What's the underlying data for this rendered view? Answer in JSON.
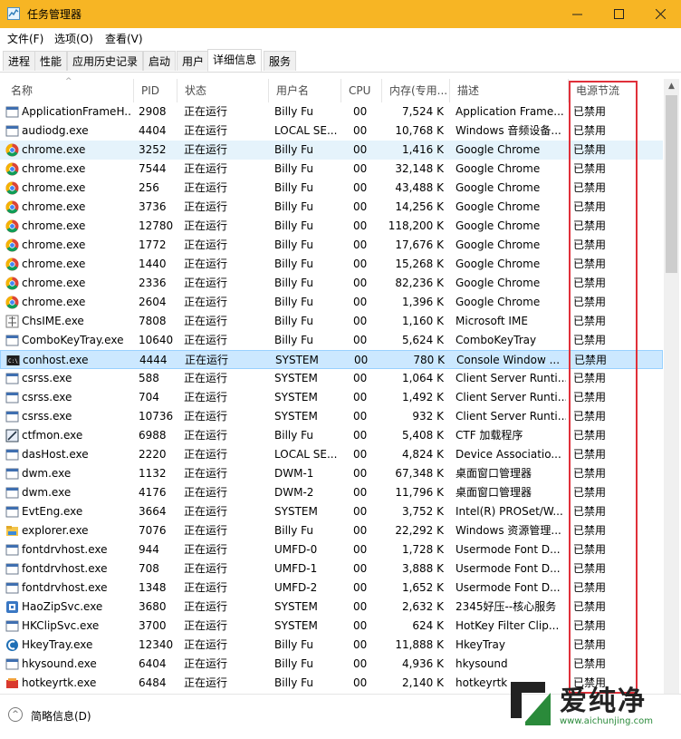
{
  "window": {
    "title": "任务管理器",
    "icon": "task-manager-icon"
  },
  "menu": [
    "文件(F)",
    "选项(O)",
    "查看(V)"
  ],
  "tabs": [
    "进程",
    "性能",
    "应用历史记录",
    "启动",
    "用户",
    "详细信息",
    "服务"
  ],
  "active_tab": "详细信息",
  "columns": [
    "名称",
    "PID",
    "状态",
    "用户名",
    "CPU",
    "内存(专用...",
    "描述",
    "电源节流"
  ],
  "rows": [
    {
      "icon": "generic-window-icon",
      "name": "ApplicationFrameH...",
      "pid": "2908",
      "status": "正在运行",
      "user": "Billy Fu",
      "cpu": "00",
      "mem": "7,524 K",
      "desc": "Application Frame...",
      "power": "已禁用"
    },
    {
      "icon": "generic-window-icon",
      "name": "audiodg.exe",
      "pid": "4404",
      "status": "正在运行",
      "user": "LOCAL SE...",
      "cpu": "00",
      "mem": "10,768 K",
      "desc": "Windows 音频设备...",
      "power": "已禁用"
    },
    {
      "icon": "chrome-icon",
      "name": "chrome.exe",
      "pid": "3252",
      "status": "正在运行",
      "user": "Billy Fu",
      "cpu": "00",
      "mem": "1,416 K",
      "desc": "Google Chrome",
      "power": "已禁用"
    },
    {
      "icon": "chrome-icon",
      "name": "chrome.exe",
      "pid": "7544",
      "status": "正在运行",
      "user": "Billy Fu",
      "cpu": "00",
      "mem": "32,148 K",
      "desc": "Google Chrome",
      "power": "已禁用"
    },
    {
      "icon": "chrome-icon",
      "name": "chrome.exe",
      "pid": "256",
      "status": "正在运行",
      "user": "Billy Fu",
      "cpu": "00",
      "mem": "43,488 K",
      "desc": "Google Chrome",
      "power": "已禁用"
    },
    {
      "icon": "chrome-icon",
      "name": "chrome.exe",
      "pid": "3736",
      "status": "正在运行",
      "user": "Billy Fu",
      "cpu": "00",
      "mem": "14,256 K",
      "desc": "Google Chrome",
      "power": "已禁用"
    },
    {
      "icon": "chrome-icon",
      "name": "chrome.exe",
      "pid": "12780",
      "status": "正在运行",
      "user": "Billy Fu",
      "cpu": "00",
      "mem": "118,200 K",
      "desc": "Google Chrome",
      "power": "已禁用"
    },
    {
      "icon": "chrome-icon",
      "name": "chrome.exe",
      "pid": "1772",
      "status": "正在运行",
      "user": "Billy Fu",
      "cpu": "00",
      "mem": "17,676 K",
      "desc": "Google Chrome",
      "power": "已禁用"
    },
    {
      "icon": "chrome-icon",
      "name": "chrome.exe",
      "pid": "1440",
      "status": "正在运行",
      "user": "Billy Fu",
      "cpu": "00",
      "mem": "15,268 K",
      "desc": "Google Chrome",
      "power": "已禁用"
    },
    {
      "icon": "chrome-icon",
      "name": "chrome.exe",
      "pid": "2336",
      "status": "正在运行",
      "user": "Billy Fu",
      "cpu": "00",
      "mem": "82,236 K",
      "desc": "Google Chrome",
      "power": "已禁用"
    },
    {
      "icon": "chrome-icon",
      "name": "chrome.exe",
      "pid": "2604",
      "status": "正在运行",
      "user": "Billy Fu",
      "cpu": "00",
      "mem": "1,396 K",
      "desc": "Google Chrome",
      "power": "已禁用"
    },
    {
      "icon": "ime-icon",
      "name": "ChsIME.exe",
      "pid": "7808",
      "status": "正在运行",
      "user": "Billy Fu",
      "cpu": "00",
      "mem": "1,160 K",
      "desc": "Microsoft IME",
      "power": "已禁用"
    },
    {
      "icon": "generic-window-icon",
      "name": "ComboKeyTray.exe",
      "pid": "10640",
      "status": "正在运行",
      "user": "Billy Fu",
      "cpu": "00",
      "mem": "5,624 K",
      "desc": "ComboKeyTray",
      "power": "已禁用"
    },
    {
      "icon": "console-icon",
      "name": "conhost.exe",
      "pid": "4444",
      "status": "正在运行",
      "user": "SYSTEM",
      "cpu": "00",
      "mem": "780 K",
      "desc": "Console Window ...",
      "power": "已禁用"
    },
    {
      "icon": "generic-window-icon",
      "name": "csrss.exe",
      "pid": "588",
      "status": "正在运行",
      "user": "SYSTEM",
      "cpu": "00",
      "mem": "1,064 K",
      "desc": "Client Server Runti...",
      "power": "已禁用"
    },
    {
      "icon": "generic-window-icon",
      "name": "csrss.exe",
      "pid": "704",
      "status": "正在运行",
      "user": "SYSTEM",
      "cpu": "00",
      "mem": "1,492 K",
      "desc": "Client Server Runti...",
      "power": "已禁用"
    },
    {
      "icon": "generic-window-icon",
      "name": "csrss.exe",
      "pid": "10736",
      "status": "正在运行",
      "user": "SYSTEM",
      "cpu": "00",
      "mem": "932 K",
      "desc": "Client Server Runti...",
      "power": "已禁用"
    },
    {
      "icon": "ctf-icon",
      "name": "ctfmon.exe",
      "pid": "6988",
      "status": "正在运行",
      "user": "Billy Fu",
      "cpu": "00",
      "mem": "5,408 K",
      "desc": "CTF 加载程序",
      "power": "已禁用"
    },
    {
      "icon": "generic-window-icon",
      "name": "dasHost.exe",
      "pid": "2220",
      "status": "正在运行",
      "user": "LOCAL SE...",
      "cpu": "00",
      "mem": "4,824 K",
      "desc": "Device Associatio...",
      "power": "已禁用"
    },
    {
      "icon": "generic-window-icon",
      "name": "dwm.exe",
      "pid": "1132",
      "status": "正在运行",
      "user": "DWM-1",
      "cpu": "00",
      "mem": "67,348 K",
      "desc": "桌面窗口管理器",
      "power": "已禁用"
    },
    {
      "icon": "generic-window-icon",
      "name": "dwm.exe",
      "pid": "4176",
      "status": "正在运行",
      "user": "DWM-2",
      "cpu": "00",
      "mem": "11,796 K",
      "desc": "桌面窗口管理器",
      "power": "已禁用"
    },
    {
      "icon": "generic-window-icon",
      "name": "EvtEng.exe",
      "pid": "3664",
      "status": "正在运行",
      "user": "SYSTEM",
      "cpu": "00",
      "mem": "3,752 K",
      "desc": "Intel(R) PROSet/W...",
      "power": "已禁用"
    },
    {
      "icon": "explorer-icon",
      "name": "explorer.exe",
      "pid": "7076",
      "status": "正在运行",
      "user": "Billy Fu",
      "cpu": "00",
      "mem": "22,292 K",
      "desc": "Windows 资源管理...",
      "power": "已禁用"
    },
    {
      "icon": "generic-window-icon",
      "name": "fontdrvhost.exe",
      "pid": "944",
      "status": "正在运行",
      "user": "UMFD-0",
      "cpu": "00",
      "mem": "1,728 K",
      "desc": "Usermode Font D...",
      "power": "已禁用"
    },
    {
      "icon": "generic-window-icon",
      "name": "fontdrvhost.exe",
      "pid": "708",
      "status": "正在运行",
      "user": "UMFD-1",
      "cpu": "00",
      "mem": "3,888 K",
      "desc": "Usermode Font D...",
      "power": "已禁用"
    },
    {
      "icon": "generic-window-icon",
      "name": "fontdrvhost.exe",
      "pid": "1348",
      "status": "正在运行",
      "user": "UMFD-2",
      "cpu": "00",
      "mem": "1,652 K",
      "desc": "Usermode Font D...",
      "power": "已禁用"
    },
    {
      "icon": "haozip-icon",
      "name": "HaoZipSvc.exe",
      "pid": "3680",
      "status": "正在运行",
      "user": "SYSTEM",
      "cpu": "00",
      "mem": "2,632 K",
      "desc": "2345好压--核心服务",
      "power": "已禁用"
    },
    {
      "icon": "generic-window-icon",
      "name": "HKClipSvc.exe",
      "pid": "3700",
      "status": "正在运行",
      "user": "SYSTEM",
      "cpu": "00",
      "mem": "624 K",
      "desc": "HotKey Filter Clip...",
      "power": "已禁用"
    },
    {
      "icon": "hkey-tray-icon",
      "name": "HkeyTray.exe",
      "pid": "12340",
      "status": "正在运行",
      "user": "Billy Fu",
      "cpu": "00",
      "mem": "11,888 K",
      "desc": "HkeyTray",
      "power": "已禁用"
    },
    {
      "icon": "generic-window-icon",
      "name": "hkysound.exe",
      "pid": "6404",
      "status": "正在运行",
      "user": "Billy Fu",
      "cpu": "00",
      "mem": "4,936 K",
      "desc": "hkysound",
      "power": "已禁用"
    },
    {
      "icon": "audio-icon",
      "name": "hotkeyrtk.exe",
      "pid": "6484",
      "status": "正在运行",
      "user": "Billy Fu",
      "cpu": "00",
      "mem": "2,140 K",
      "desc": "hotkeyrtk",
      "power": "已禁用"
    }
  ],
  "hover_row": 2,
  "selected_row": 13,
  "footer": {
    "label": "简略信息(D)",
    "icon": "chevron-up-icon"
  },
  "watermark": {
    "text": "爱纯净",
    "url": "www.aichunjing.com"
  },
  "colors": {
    "titlebar": "#f7b524",
    "highlight_border": "#e0303a",
    "selected": "#cce8ff",
    "hover": "#e5f3fb"
  }
}
